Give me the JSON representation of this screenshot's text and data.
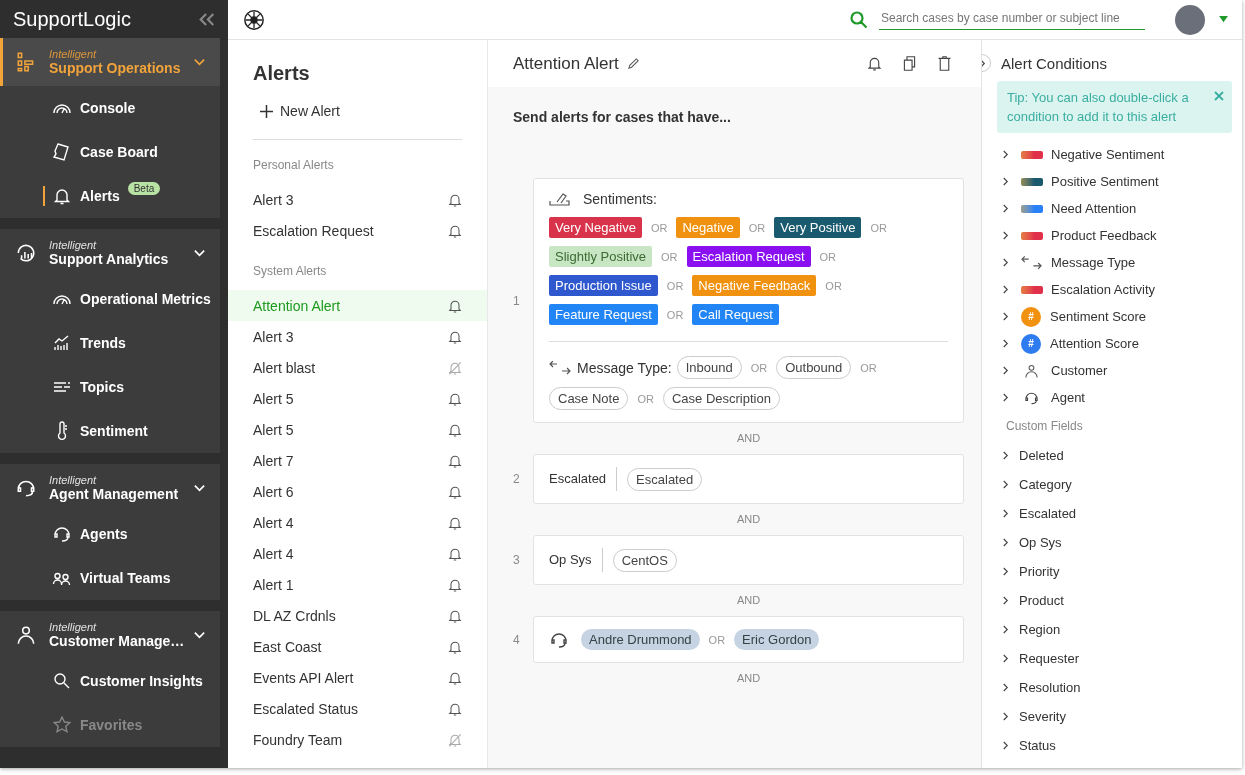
{
  "topbar": {
    "search": {
      "placeholder": "Search cases by case number or subject line"
    }
  },
  "sidebar": {
    "logo": "**Support**Logic",
    "groups": [
      {
        "kicker": "Intelligent",
        "title": "Support Operations",
        "selected": true,
        "expanded": true,
        "items": [
          {
            "label": "Console",
            "selected": false,
            "disabled": false
          },
          {
            "label": "Case Board",
            "selected": false,
            "disabled": false
          },
          {
            "label": "Alerts",
            "selected": true,
            "disabled": false,
            "badge": "Beta"
          }
        ]
      },
      {
        "kicker": "Intelligent",
        "title": "Support Analytics",
        "selected": false,
        "expanded": true,
        "items": [
          {
            "label": "Operational Metrics",
            "selected": false,
            "disabled": false
          },
          {
            "label": "Trends",
            "selected": false,
            "disabled": false
          },
          {
            "label": "Topics",
            "selected": false,
            "disabled": false
          },
          {
            "label": "Sentiment",
            "selected": false,
            "disabled": false
          }
        ]
      },
      {
        "kicker": "Intelligent",
        "title": "Agent Management",
        "selected": false,
        "expanded": true,
        "items": [
          {
            "label": "Agents",
            "selected": false,
            "disabled": false
          },
          {
            "label": "Virtual Teams",
            "selected": false,
            "disabled": false
          }
        ]
      },
      {
        "kicker": "Intelligent",
        "title": "Customer Manage…",
        "selected": false,
        "expanded": true,
        "items": [
          {
            "label": "Customer Insights",
            "selected": false,
            "disabled": false
          },
          {
            "label": "Favorites",
            "selected": false,
            "disabled": true
          }
        ]
      }
    ]
  },
  "alerts": {
    "title": "Alerts",
    "new_button": "New Alert",
    "sections": [
      {
        "heading": "Personal Alerts",
        "items": [
          {
            "label": "Alert 3",
            "selected": false,
            "muted": false
          },
          {
            "label": "Escalation Request",
            "selected": false,
            "muted": false
          }
        ]
      },
      {
        "heading": "System Alerts",
        "items": [
          {
            "label": "Attention Alert",
            "selected": true,
            "muted": false
          },
          {
            "label": "Alert 3",
            "selected": false,
            "muted": false
          },
          {
            "label": "Alert blast",
            "selected": false,
            "muted": true
          },
          {
            "label": "Alert 5",
            "selected": false,
            "muted": false
          },
          {
            "label": "Alert 5",
            "selected": false,
            "muted": false
          },
          {
            "label": "Alert 7",
            "selected": false,
            "muted": false
          },
          {
            "label": "Alert 6",
            "selected": false,
            "muted": false
          },
          {
            "label": "Alert 4",
            "selected": false,
            "muted": false
          },
          {
            "label": "Alert 4",
            "selected": false,
            "muted": false
          },
          {
            "label": "Alert 1",
            "selected": false,
            "muted": false
          },
          {
            "label": "DL AZ Crdnls",
            "selected": false,
            "muted": false
          },
          {
            "label": "East Coast",
            "selected": false,
            "muted": false
          },
          {
            "label": "Events API Alert",
            "selected": false,
            "muted": false
          },
          {
            "label": "Escalated Status",
            "selected": false,
            "muted": false
          },
          {
            "label": "Foundry Team",
            "selected": false,
            "muted": true
          }
        ]
      }
    ]
  },
  "editor": {
    "title": "Attention Alert",
    "intro": "Send alerts for cases that have...",
    "conditions": [
      {
        "number": "1",
        "kind": "groups",
        "groups": [
          {
            "kind": "sentiment",
            "label": "Sentiments:",
            "chips": [
              {
                "label": "Very Negative",
                "color": "#d8334a",
                "separator": "OR"
              },
              {
                "label": "Negative",
                "color": "#f0920f",
                "separator": "OR"
              },
              {
                "label": "Very Positive",
                "color": "#1a5a6e",
                "separator": "OR"
              },
              {
                "label": "Slightly Positive",
                "color": "#c8e6c4",
                "separator": "OR"
              },
              {
                "label": "Escalation Request",
                "color": "#8a10f2",
                "separator": "OR"
              },
              {
                "label": "Production Issue",
                "color": "#2f58cf",
                "separator": "OR"
              },
              {
                "label": "Negative Feedback",
                "color": "#f0920f",
                "separator": "OR"
              },
              {
                "label": "Feature Request",
                "color": "#2285f6",
                "separator": "OR"
              },
              {
                "label": "Call Request",
                "color": "#2285f6"
              }
            ]
          },
          {
            "kind": "message",
            "label": "Message Type:",
            "chips": [
              {
                "label": "Inbound",
                "separator": "OR"
              },
              {
                "label": "Outbound",
                "separator": "OR"
              },
              {
                "label": "Case Note",
                "separator": "OR"
              },
              {
                "label": "Case Description"
              }
            ]
          }
        ]
      },
      {
        "number": "2",
        "kind": "field",
        "label": "Escalated",
        "chips": [
          {
            "label": "Escalated"
          }
        ]
      },
      {
        "number": "3",
        "kind": "field",
        "label": "Op Sys",
        "chips": [
          {
            "label": "CentOS"
          }
        ]
      },
      {
        "number": "4",
        "kind": "agent",
        "chips": [
          {
            "label": "Andre Drummond",
            "separator": "OR"
          },
          {
            "label": "Eric Gordon"
          }
        ]
      }
    ],
    "joins": [
      "AND",
      "AND",
      "AND",
      "AND"
    ]
  },
  "conditions_panel": {
    "title": "Alert Conditions",
    "tip": "Tip: You can also double-click a condition to add it to this alert",
    "items": [
      {
        "label": "Negative Sentiment",
        "kind": "gradient",
        "color": "#e0304a"
      },
      {
        "label": "Positive Sentiment",
        "kind": "gradient",
        "color": "#1a5a6e"
      },
      {
        "label": "Need Attention",
        "kind": "gradient",
        "color": "#2a80f5"
      },
      {
        "label": "Product Feedback",
        "kind": "gradient",
        "color": "#e0304a"
      },
      {
        "label": "Message Type",
        "kind": "message"
      },
      {
        "label": "Escalation Activity",
        "kind": "gradient",
        "color": "#e0304a"
      },
      {
        "label": "Sentiment Score",
        "kind": "score",
        "symbol": "#",
        "color": "#f0920f"
      },
      {
        "label": "Attention Score",
        "kind": "score",
        "symbol": "#",
        "color": "#2f7cf0"
      },
      {
        "label": "Customer",
        "kind": "customer"
      },
      {
        "label": "Agent",
        "kind": "agent"
      }
    ],
    "custom_heading": "Custom Fields",
    "custom_fields": [
      "Deleted",
      "Category",
      "Escalated",
      "Op Sys",
      "Priority",
      "Product",
      "Region",
      "Requester",
      "Resolution",
      "Severity",
      "Status"
    ]
  }
}
